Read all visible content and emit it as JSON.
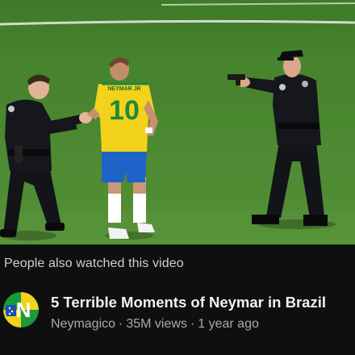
{
  "thumbnail": {
    "jersey_name": "NEYMAR JR",
    "jersey_number": "10"
  },
  "section": {
    "header": "People also watched this video"
  },
  "video": {
    "title": "5 Terrible Moments of Neymar in Brazil",
    "channel": "Neymagico",
    "views": "35M views",
    "age": "1 year ago",
    "separator": "·"
  },
  "avatar": {
    "letter": "N"
  },
  "colors": {
    "background": "#0f0f0f",
    "pitch": "#4e8a30",
    "jersey_yellow": "#f2d21b",
    "shorts_blue": "#1e63c8",
    "jersey_number_green": "#1c8a3a"
  }
}
